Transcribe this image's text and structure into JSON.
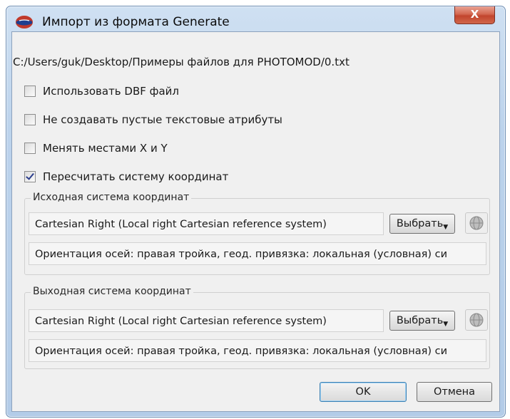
{
  "window": {
    "title": "Импорт из формата Generate",
    "close_label": "X"
  },
  "file_path": "C:/Users/guk/Desktop/Примеры файлов для PHOTOMOD/0.txt",
  "options": [
    {
      "label": "Использовать DBF файл",
      "checked": false
    },
    {
      "label": "Не создавать пустые текстовые атрибуты",
      "checked": false
    },
    {
      "label": "Менять местами X и Y",
      "checked": false
    },
    {
      "label": "Пересчитать систему координат",
      "checked": true
    }
  ],
  "source_cs": {
    "group_label": "Исходная система координат",
    "name": "Cartesian Right (Local right Cartesian reference system)",
    "choose_label": "Выбрать",
    "description": "Ориентация осей: правая тройка, геод. привязка: локальная (условная) си"
  },
  "target_cs": {
    "group_label": "Выходная система координат",
    "name": "Cartesian Right (Local right Cartesian reference system)",
    "choose_label": "Выбрать",
    "description": "Ориентация осей: правая тройка, геод. привязка: локальная (условная) си"
  },
  "buttons": {
    "ok": "OK",
    "cancel": "Отмена"
  },
  "icons": {
    "app": "app-icon",
    "globe": "globe-icon",
    "dropdown": "dropdown-arrow-icon"
  }
}
